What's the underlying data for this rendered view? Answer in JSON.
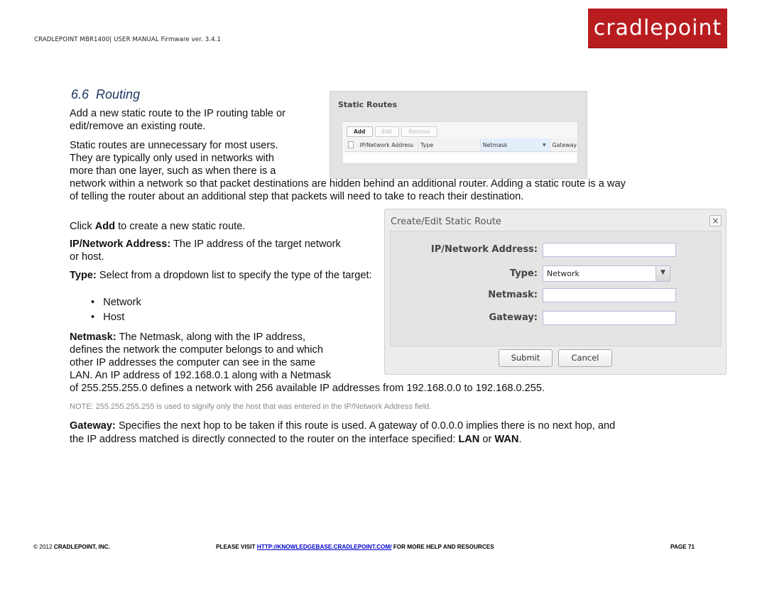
{
  "header": {
    "manual_title": "CRADLEPOINT MBR1400| USER MANUAL Firmware ver. 3.4.1",
    "logo_text": "cradlepoint",
    "brand_color": "#b81c1f"
  },
  "section": {
    "number": "6.6",
    "title": "Routing"
  },
  "paragraphs": {
    "intro_1": "Add a new static route to the IP routing table or edit/remove an existing route.",
    "intro_2_lines": [
      "Static routes are unnecessary for most users.",
      "They are typically only used in networks with",
      "more than one layer, such as when there is a",
      "network within a network so that packet destinations are hidden behind an additional router. Adding a static route is a way",
      "of telling the router about an additional step that packets will need to take to reach their destination."
    ],
    "click_add_prefix": "Click ",
    "click_add_bold": "Add",
    "click_add_suffix": " to create a new static route.",
    "ip_label": "IP/Network Address:",
    "ip_text": " The IP address of the target network or host.",
    "type_label": "Type:",
    "type_text": " Select from a dropdown list to specify the type of the target:",
    "type_options": [
      "Network",
      "Host"
    ],
    "netmask_label": "Netmask:",
    "netmask_lines": [
      " The Netmask, along with the IP address,",
      "defines the network the computer belongs to and which",
      "other IP addresses the computer can see in the same",
      "LAN. An IP address of 192.168.0.1 along with a Netmask",
      "of 255.255.255.0 defines a network with 256 available IP addresses from 192.168.0.0 to 192.168.0.255."
    ],
    "note": "NOTE: 255.255.255.255 is used to signify only the host that was entered in the IP/Network Address field.",
    "gateway_label": "Gateway:",
    "gateway_text_1": " Specifies the next hop to be taken if this route is used. A gateway of 0.0.0.0 implies there is no next hop, and",
    "gateway_text_2": "the IP address matched is directly connected to the router on the interface specified: ",
    "gateway_lan": "LAN",
    "gateway_or": " or ",
    "gateway_wan": "WAN",
    "gateway_end": "."
  },
  "static_routes_panel": {
    "title": "Static Routes",
    "buttons": {
      "add": "Add",
      "edit": "Edit",
      "remove": "Remove"
    },
    "columns": [
      "IP/Network Address",
      "Type",
      "Netmask",
      "Gateway"
    ]
  },
  "dialog": {
    "title": "Create/Edit Static Route",
    "close_label": "×",
    "fields": {
      "ip_label": "IP/Network Address:",
      "ip_value": "",
      "type_label": "Type:",
      "type_value": "Network",
      "netmask_label": "Netmask:",
      "netmask_value": "",
      "gateway_label": "Gateway:",
      "gateway_value": ""
    },
    "submit_label": "Submit",
    "cancel_label": "Cancel"
  },
  "footer": {
    "copyright_prefix": "© 2012 ",
    "company": "CRADLEPOINT, INC.",
    "visit_prefix": "PLEASE VISIT ",
    "link": "HTTP://KNOWLEDGEBASE.CRADLEPOINT.COM/",
    "visit_suffix": " FOR MORE HELP AND RESOURCES",
    "page": "PAGE 71"
  }
}
